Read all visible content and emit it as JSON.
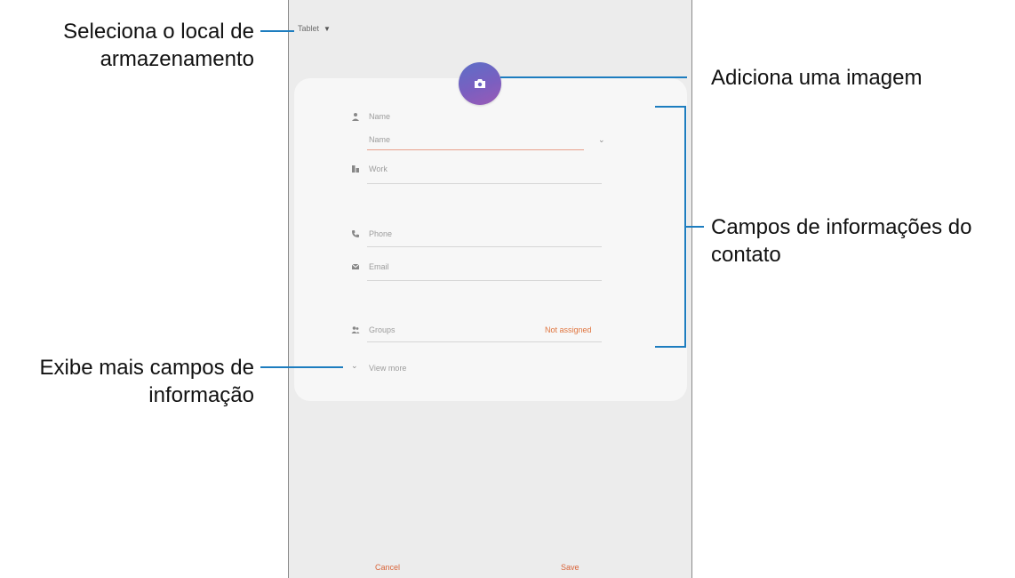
{
  "callouts": {
    "storage_line1": "Seleciona o local de",
    "storage_line2": "armazenamento",
    "image": "Adiciona uma imagem",
    "fields_line1": "Campos de informações do",
    "fields_line2": "contato",
    "more_line1": "Exibe mais campos de",
    "more_line2": "informação"
  },
  "phone": {
    "storage_label": "Tablet",
    "fields": {
      "name_label": "Name",
      "name_value": "Name",
      "work_label": "Work",
      "phone_label": "Phone",
      "email_label": "Email",
      "groups_label": "Groups",
      "groups_action": "Not assigned"
    },
    "view_more": "View more",
    "buttons": {
      "cancel": "Cancel",
      "save": "Save"
    }
  },
  "colors": {
    "leader_line": "#1d7dbf",
    "accent": "#e0753f",
    "avatar": "#6a66c4"
  },
  "icons": [
    "camera-icon",
    "person-icon",
    "work-icon",
    "phone-icon",
    "email-icon",
    "groups-icon",
    "chevron-down-icon",
    "dropdown-caret-icon"
  ]
}
